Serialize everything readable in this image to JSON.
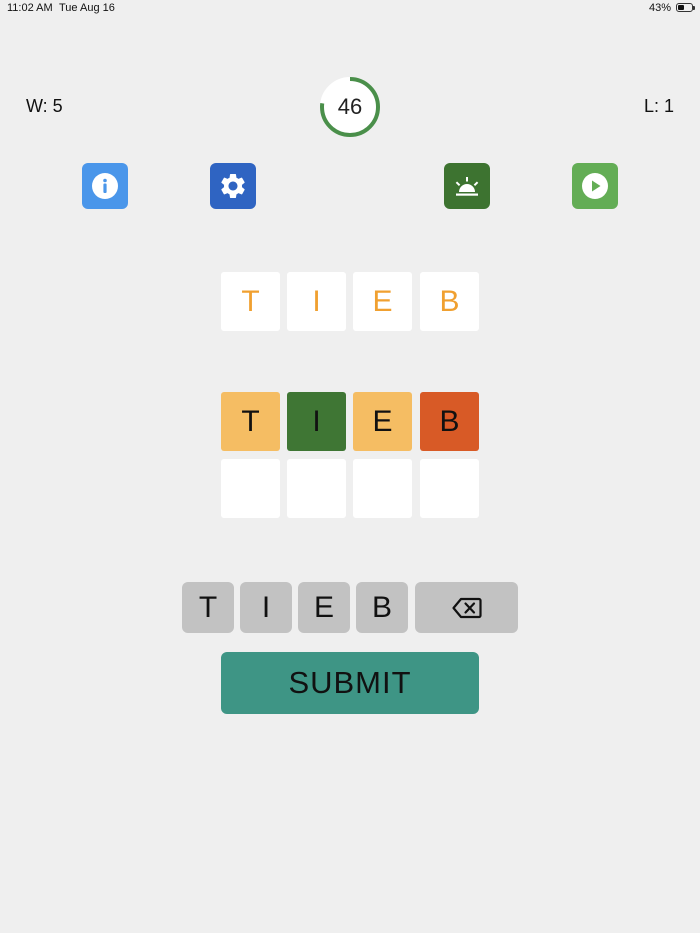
{
  "status_bar": {
    "time": "11:02 AM",
    "date": "Tue Aug 16",
    "battery_text": "43%",
    "battery_level": 0.43
  },
  "header": {
    "wins": "W: 5",
    "losses": "L: 1",
    "timer_value": "46",
    "timer_fraction": 0.77,
    "timer_color": "#4a8f4a"
  },
  "toolbar": {
    "info": {
      "icon": "info-icon",
      "color": "#4a96ea"
    },
    "settings": {
      "icon": "gear-icon",
      "color": "#2f64c2"
    },
    "hint": {
      "icon": "sunrise-icon",
      "color": "#3d7330"
    },
    "play": {
      "icon": "play-icon",
      "color": "#63ad55"
    }
  },
  "target_word": [
    "T",
    "I",
    "E",
    "B"
  ],
  "guess_rows": [
    [
      {
        "letter": "T",
        "color": "#f5bd63"
      },
      {
        "letter": "I",
        "color": "#3f7634"
      },
      {
        "letter": "E",
        "color": "#f5bd63"
      },
      {
        "letter": "B",
        "color": "#d85a26"
      }
    ],
    [
      {
        "letter": "",
        "color": "#ffffff"
      },
      {
        "letter": "",
        "color": "#ffffff"
      },
      {
        "letter": "",
        "color": "#ffffff"
      },
      {
        "letter": "",
        "color": "#ffffff"
      }
    ]
  ],
  "keyboard": {
    "keys": [
      "T",
      "I",
      "E",
      "B"
    ],
    "backspace_icon": "backspace-icon"
  },
  "submit_label": "SUBMIT",
  "colors": {
    "target_letter": "#f0a030",
    "key_bg": "#c2c2c2",
    "submit_bg": "#3e9585",
    "background": "#efefef"
  }
}
